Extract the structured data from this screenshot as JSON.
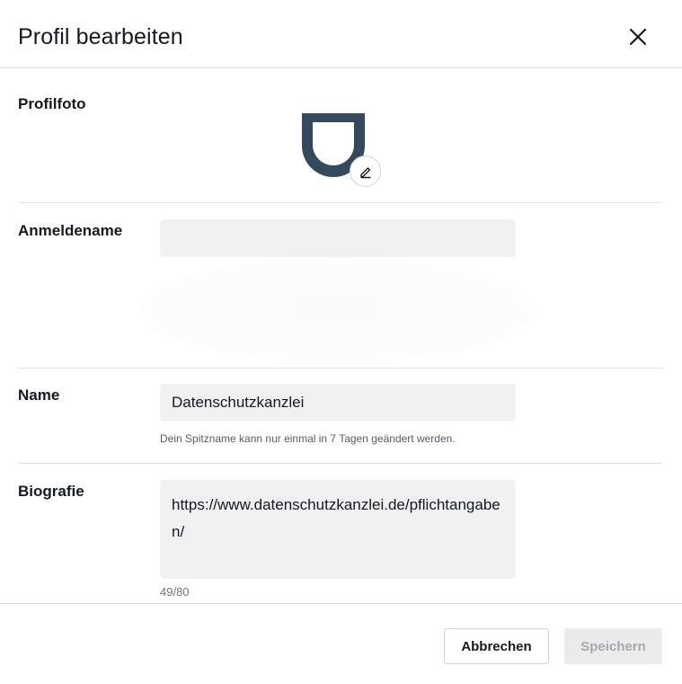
{
  "dialog": {
    "title": "Profil bearbeiten",
    "close_icon": "close-icon"
  },
  "profile_photo": {
    "label": "Profilfoto",
    "avatar_icon": "shield-avatar",
    "edit_icon": "pencil-icon",
    "color": "#34495e"
  },
  "username": {
    "label": "Anmeldename",
    "value": ""
  },
  "name": {
    "label": "Name",
    "value": "Datenschutzkanzlei",
    "hint": "Dein Spitzname kann nur einmal in 7 Tagen geändert werden."
  },
  "bio": {
    "label": "Biografie",
    "value": "https://www.datenschutzkanzlei.de/pflichtangaben/",
    "counter": "49/80"
  },
  "footer": {
    "cancel_label": "Abbrechen",
    "save_label": "Speichern"
  }
}
